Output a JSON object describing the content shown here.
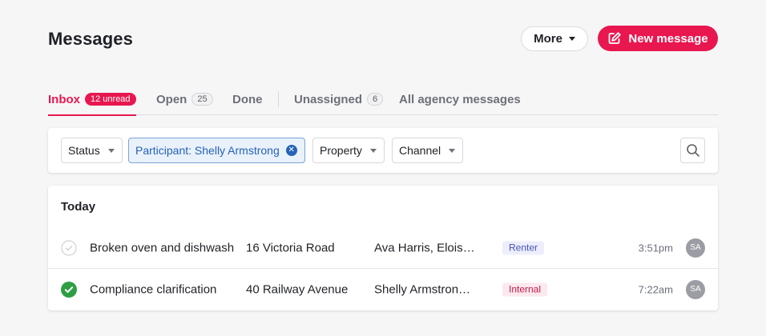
{
  "header": {
    "title": "Messages",
    "more_label": "More",
    "new_message_label": "New message"
  },
  "tabs": [
    {
      "label": "Inbox",
      "badge": "12 unread",
      "active": true
    },
    {
      "label": "Open",
      "badge": "25"
    },
    {
      "label": "Done"
    },
    {
      "label": "Unassigned",
      "badge": "6"
    },
    {
      "label": "All agency messages"
    }
  ],
  "filters": {
    "status": "Status",
    "participant_chip": "Participant: Shelly Armstrong",
    "property": "Property",
    "channel": "Channel"
  },
  "list": {
    "section_title": "Today",
    "rows": [
      {
        "status": "unchecked",
        "subject": "Broken oven and dishwash",
        "property": "16 Victoria Road",
        "participants": "Ava Harris, Elois…",
        "tag": "Renter",
        "time": "3:51pm",
        "avatar": "SA"
      },
      {
        "status": "checked",
        "subject": "Compliance clarification",
        "property": "40 Railway Avenue",
        "participants": "Shelly Armstron…",
        "tag": "Internal",
        "time": "7:22am",
        "avatar": "SA"
      }
    ]
  },
  "colors": {
    "accent": "#e8174f",
    "chip_blue": "#2563b6",
    "done_green": "#2e9e44",
    "background": "#f6f6f7"
  },
  "icons": {
    "new_message": "compose-icon",
    "search": "search-icon",
    "chip_clear": "close-circle-icon",
    "row_status_open": "circle-check-outline-icon",
    "row_status_done": "circle-check-filled-icon"
  }
}
